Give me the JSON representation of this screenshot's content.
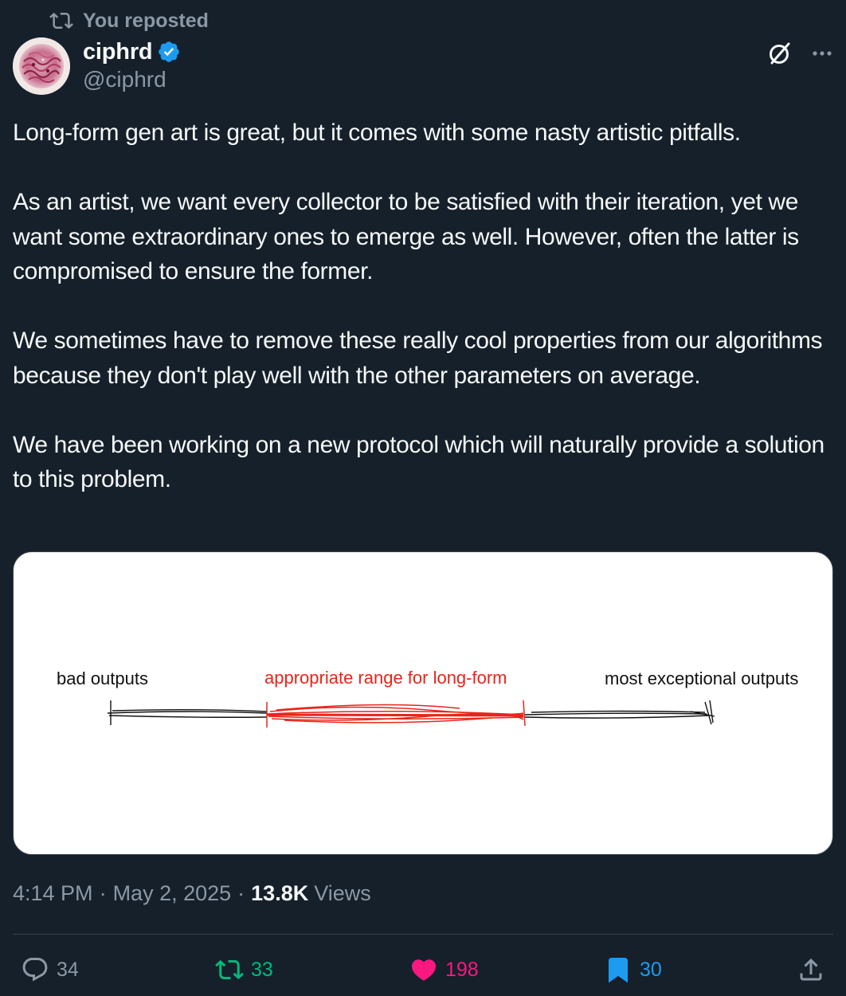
{
  "repost_context": {
    "label": "You reposted",
    "icon": "repost-icon"
  },
  "author": {
    "name": "ciphrd",
    "handle": "@ciphrd",
    "verified": true,
    "verified_color": "#1d9bf0"
  },
  "tweet": {
    "paragraphs": [
      "Long-form gen art is great, but it comes with some nasty artistic pitfalls.",
      "As an artist, we want every collector to be satisfied with their iteration, yet we want some extraordinary ones to emerge as well. However, often the latter is compromised to ensure the former.",
      "We sometimes have to remove these really cool properties from our algorithms because they don't play well with the other parameters on average.",
      "We have been working on a new protocol which will naturally provide a solution to this problem."
    ]
  },
  "media": {
    "label_left": "bad outputs",
    "label_middle": "appropriate range for long-form",
    "label_right": "most exceptional outputs",
    "highlight_color": "#e8251b"
  },
  "meta": {
    "time": "4:14 PM",
    "date": "May 2, 2025",
    "views_count": "13.8K",
    "views_label": "Views",
    "separator": "·"
  },
  "actions": {
    "reply": {
      "count": "34",
      "icon": "reply-icon"
    },
    "repost": {
      "count": "33",
      "icon": "repost-icon",
      "color": "#00ba7c"
    },
    "like": {
      "count": "198",
      "icon": "heart-icon",
      "color": "#f91880"
    },
    "bookmark": {
      "count": "30",
      "icon": "bookmark-icon",
      "color": "#1d9bf0"
    },
    "share": {
      "icon": "share-icon"
    }
  },
  "top_actions": {
    "grok_icon": "grok-icon",
    "more_icon": "more-icon"
  }
}
